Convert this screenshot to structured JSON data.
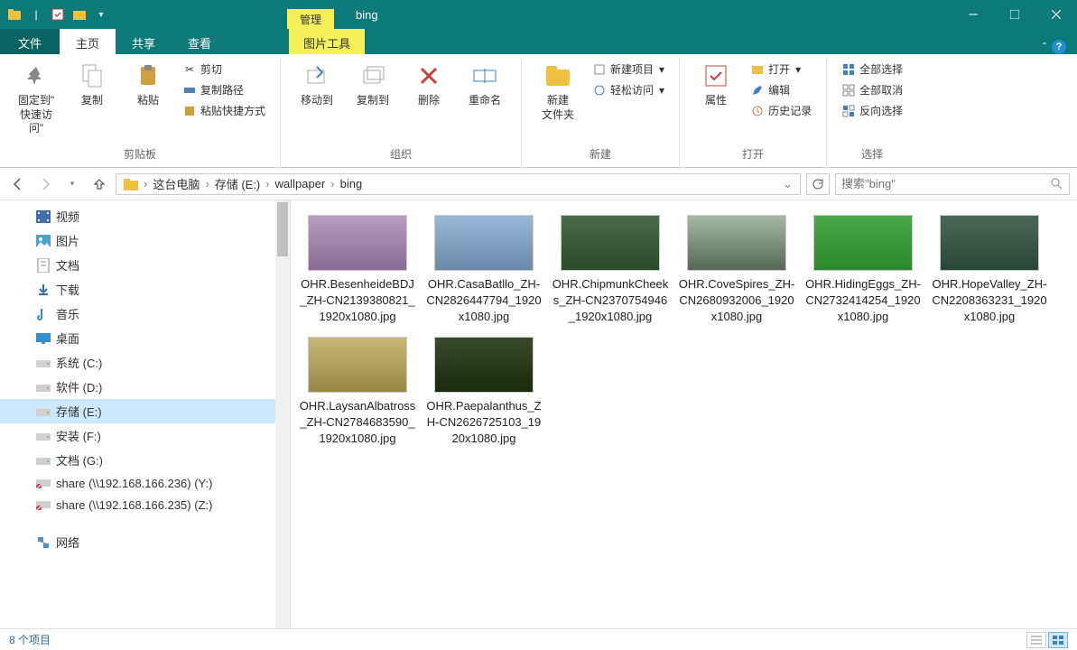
{
  "title": "bing",
  "tool_context_label": "管理",
  "tabs": {
    "file": "文件",
    "home": "主页",
    "share": "共享",
    "view": "查看",
    "picture_tools": "图片工具"
  },
  "ribbon": {
    "clipboard": {
      "label": "剪贴板",
      "pin": "固定到\"\n快速访问\"",
      "copy": "复制",
      "paste": "粘贴",
      "cut": "剪切",
      "copy_path": "复制路径",
      "paste_shortcut": "粘贴快捷方式"
    },
    "organize": {
      "label": "组织",
      "move_to": "移动到",
      "copy_to": "复制到",
      "delete": "删除",
      "rename": "重命名"
    },
    "new": {
      "label": "新建",
      "new_folder": "新建\n文件夹",
      "new_item": "新建项目",
      "easy_access": "轻松访问"
    },
    "open": {
      "label": "打开",
      "properties": "属性",
      "open": "打开",
      "edit": "编辑",
      "history": "历史记录"
    },
    "select": {
      "label": "选择",
      "select_all": "全部选择",
      "select_none": "全部取消",
      "invert": "反向选择"
    }
  },
  "breadcrumb": [
    "这台电脑",
    "存储 (E:)",
    "wallpaper",
    "bing"
  ],
  "search_placeholder": "搜索\"bing\"",
  "tree": [
    {
      "icon": "video",
      "label": "视频"
    },
    {
      "icon": "pictures",
      "label": "图片"
    },
    {
      "icon": "documents",
      "label": "文档"
    },
    {
      "icon": "downloads",
      "label": "下载"
    },
    {
      "icon": "music",
      "label": "音乐"
    },
    {
      "icon": "desktop",
      "label": "桌面"
    },
    {
      "icon": "drive",
      "label": "系统 (C:)"
    },
    {
      "icon": "drive",
      "label": "软件 (D:)"
    },
    {
      "icon": "drive",
      "label": "存储 (E:)",
      "selected": true
    },
    {
      "icon": "drive",
      "label": "安装 (F:)"
    },
    {
      "icon": "drive",
      "label": "文档 (G:)"
    },
    {
      "icon": "netdrive",
      "label": "share (\\\\192.168.166.236) (Y:)"
    },
    {
      "icon": "netdrive",
      "label": "share (\\\\192.168.166.235) (Z:)"
    },
    {
      "icon": "network",
      "label": "网络",
      "spacer": true
    }
  ],
  "files": [
    {
      "name": "OHR.BesenheideBDJ_ZH-CN2139380821_1920x1080.jpg",
      "bg": "linear-gradient(#b89ec0,#8a6a94)"
    },
    {
      "name": "OHR.CasaBatllo_ZH-CN2826447794_1920x1080.jpg",
      "bg": "linear-gradient(#9ab8d8,#6a88a8)"
    },
    {
      "name": "OHR.ChipmunkCheeks_ZH-CN2370754946_1920x1080.jpg",
      "bg": "linear-gradient(#4a6a4a,#2a4a2a)"
    },
    {
      "name": "OHR.CoveSpires_ZH-CN2680932006_1920x1080.jpg",
      "bg": "linear-gradient(#a8b8a8,#586858)"
    },
    {
      "name": "OHR.HidingEggs_ZH-CN2732414254_1920x1080.jpg",
      "bg": "linear-gradient(#4aa84a,#2a882a)"
    },
    {
      "name": "OHR.HopeValley_ZH-CN2208363231_1920x1080.jpg",
      "bg": "linear-gradient(#4a6858,#2a4838)"
    },
    {
      "name": "OHR.LaysanAlbatross_ZH-CN2784683590_1920x1080.jpg",
      "bg": "linear-gradient(#c8b878,#988848)"
    },
    {
      "name": "OHR.Paepalanthus_ZH-CN2626725103_1920x1080.jpg",
      "bg": "linear-gradient(#3a4a2a,#1a2a0a)"
    }
  ],
  "status": "8 个项目"
}
